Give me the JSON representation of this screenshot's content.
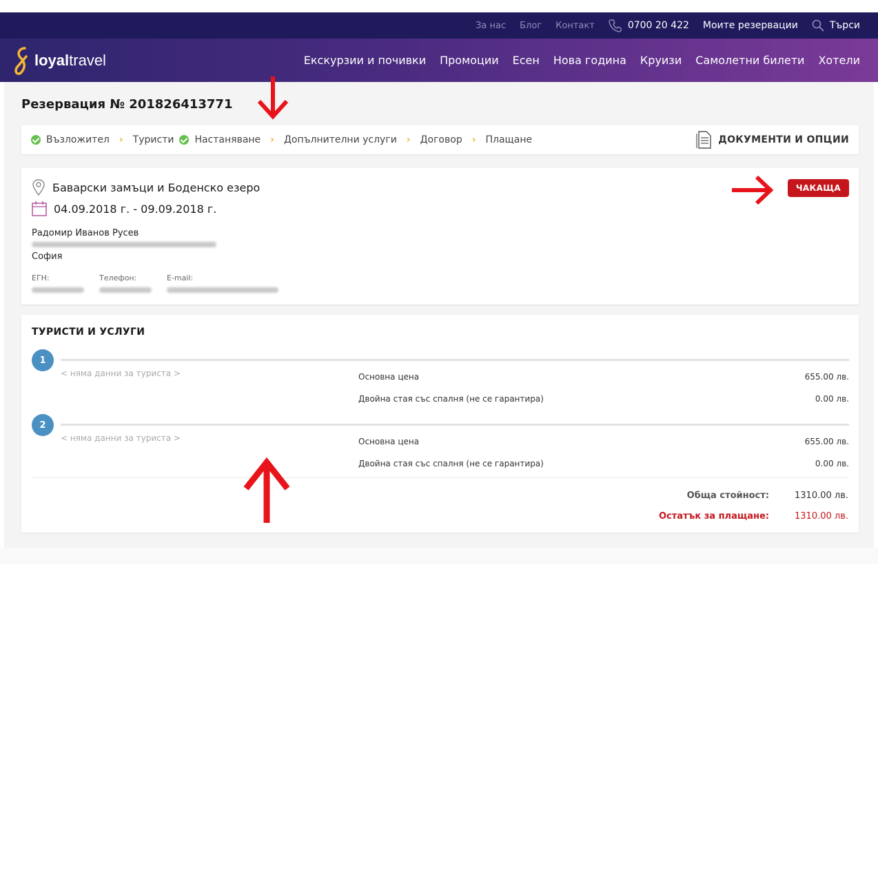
{
  "topbar": {
    "about": "За нас",
    "blog": "Блог",
    "contacts": "Контакт",
    "phone": "0700 20 422",
    "my_reservations": "Моите резервации",
    "search": "Търси"
  },
  "brand": {
    "name_bold": "loyal",
    "name_light": "travel"
  },
  "nav": {
    "items": [
      "Екскурзии и почивки",
      "Промоции",
      "Есен",
      "Нова година",
      "Круизи",
      "Самолетни билети",
      "Хотели"
    ]
  },
  "reservation": {
    "title": "Резервация № 201826413771"
  },
  "steps": {
    "items": [
      {
        "label": "Възложител",
        "done": true
      },
      {
        "label": "Туристи",
        "done": false
      },
      {
        "label": "Настаняване",
        "done": true
      },
      {
        "label": "Допълнителни услуги",
        "done": false
      },
      {
        "label": "Договор",
        "done": false
      },
      {
        "label": "Плащане",
        "done": false
      }
    ],
    "docs_label": "ДОКУМЕНТИ И ОПЦИИ"
  },
  "info": {
    "tour_name": "Баварски замъци и Боденско езеро",
    "dates": "04.09.2018 г. - 09.09.2018 г.",
    "client_name": "Радомир Иванов Русев",
    "city": "София",
    "egn_label": "ЕГН:",
    "phone_label": "Телефон:",
    "email_label": "E-mail:",
    "status": "ЧАКАЩА"
  },
  "tourists": {
    "title": "ТУРИСТИ И УСЛУГИ",
    "rows": [
      {
        "number": "1",
        "nodata": "< няма данни за туриста >",
        "service1": "Основна цена",
        "price1": "655.00 лв.",
        "service2": "Двойна стая със спалня (не се гарантира)",
        "price2": "0.00 лв."
      },
      {
        "number": "2",
        "nodata": "< няма данни за туриста >",
        "service1": "Основна цена",
        "price1": "655.00 лв.",
        "service2": "Двойна стая със спалня (не се гарантира)",
        "price2": "0.00 лв."
      }
    ],
    "total_label": "Обща стойност:",
    "total_value": "1310.00 лв.",
    "remaining_label": "Остатък за плащане:",
    "remaining_value": "1310.00 лв."
  },
  "colors": {
    "topbar_bg": "#1e1a5c",
    "nav_gradient_start": "#2e256e",
    "nav_gradient_end": "#7a3a98",
    "status_red": "#c5161d",
    "step_check": "#66c04e",
    "step_chevron": "#f0b429",
    "tourist_number": "#4a90c2",
    "annotation_arrow": "#e8141b"
  }
}
